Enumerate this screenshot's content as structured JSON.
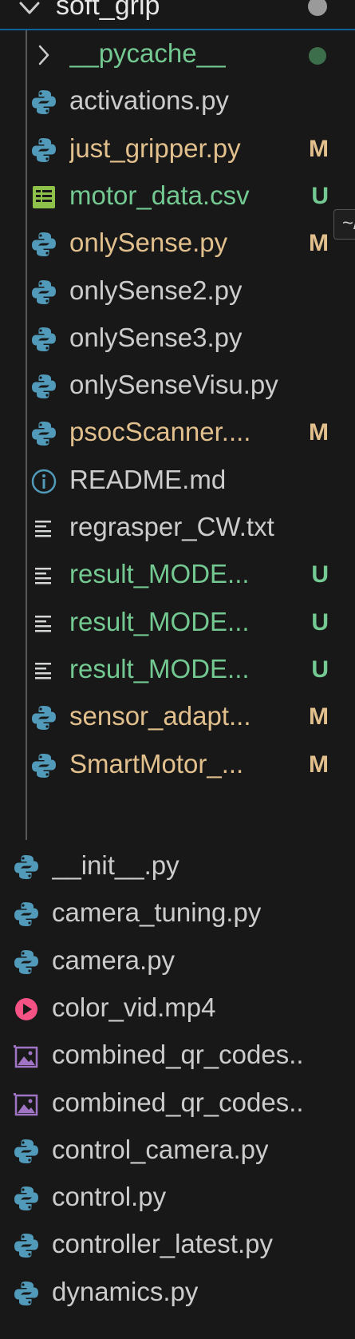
{
  "colors": {
    "modified": "#e2c08d",
    "untracked": "#73c991",
    "default_text": "#cccccc",
    "python_icon": "#519aba",
    "csv_icon": "#8dc149",
    "info_icon": "#519aba",
    "video_icon": "#f55385",
    "image_icon": "#a074c4",
    "text_icon": "#d4d7d6"
  },
  "folder": {
    "name": "soft_grip",
    "expanded": true,
    "icon": "chevron-down-icon"
  },
  "tooltip_stub": "~/",
  "tree": [
    {
      "label": "__pycache__",
      "kind": "folder-collapsed",
      "status": "untracked",
      "badge": "",
      "badge_dot": true
    },
    {
      "label": "activations.py",
      "kind": "python",
      "status": "",
      "badge": ""
    },
    {
      "label": "just_gripper.py",
      "kind": "python",
      "status": "modified",
      "badge": "M"
    },
    {
      "label": "motor_data.csv",
      "kind": "csv",
      "status": "untracked",
      "badge": "U"
    },
    {
      "label": "onlySense.py",
      "kind": "python",
      "status": "modified",
      "badge": "M"
    },
    {
      "label": "onlySense2.py",
      "kind": "python",
      "status": "",
      "badge": ""
    },
    {
      "label": "onlySense3.py",
      "kind": "python",
      "status": "",
      "badge": ""
    },
    {
      "label": "onlySenseVisu.py",
      "kind": "python",
      "status": "",
      "badge": ""
    },
    {
      "label": "psocScanner....",
      "kind": "python",
      "status": "modified",
      "badge": "M"
    },
    {
      "label": "README.md",
      "kind": "info",
      "status": "",
      "badge": ""
    },
    {
      "label": "regrasper_CW.txt",
      "kind": "text",
      "status": "",
      "badge": ""
    },
    {
      "label": "result_MODE...",
      "kind": "text",
      "status": "untracked",
      "badge": "U"
    },
    {
      "label": "result_MODE...",
      "kind": "text",
      "status": "untracked",
      "badge": "U"
    },
    {
      "label": "result_MODE...",
      "kind": "text",
      "status": "untracked",
      "badge": "U"
    },
    {
      "label": "sensor_adapt...",
      "kind": "python",
      "status": "modified",
      "badge": "M"
    },
    {
      "label": "SmartMotor_...",
      "kind": "python",
      "status": "modified",
      "badge": "M"
    }
  ],
  "outer_files": [
    {
      "label": "__init__.py",
      "kind": "python"
    },
    {
      "label": "camera_tuning.py",
      "kind": "python"
    },
    {
      "label": "camera.py",
      "kind": "python"
    },
    {
      "label": "color_vid.mp4",
      "kind": "video"
    },
    {
      "label": "combined_qr_codes..",
      "kind": "image"
    },
    {
      "label": "combined_qr_codes..",
      "kind": "image"
    },
    {
      "label": "control_camera.py",
      "kind": "python"
    },
    {
      "label": "control.py",
      "kind": "python"
    },
    {
      "label": "controller_latest.py",
      "kind": "python"
    },
    {
      "label": "dynamics.py",
      "kind": "python"
    }
  ]
}
